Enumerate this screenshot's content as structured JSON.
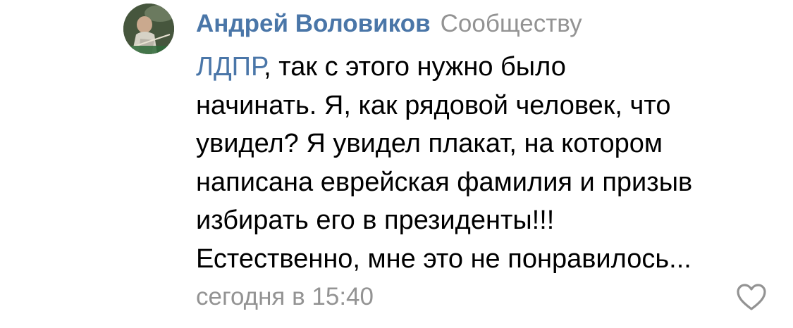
{
  "comment": {
    "author_name": "Андрей Воловиков",
    "reply_to": "Сообществу",
    "mention": "ЛДПР",
    "text_lines": [
      ", так с этого нужно было",
      "начинать. Я, как рядовой человек, что",
      "увидел? Я увидел плакат, на котором",
      "написана еврейская фамилия и призыв",
      "избирать его в президенты!!!",
      "Естественно, мне это не понравилось..."
    ],
    "timestamp": "сегодня в 15:40",
    "avatar_icon": "billiards-player-avatar",
    "like_icon": "heart-outline-icon"
  },
  "colors": {
    "link": "#4a76a8",
    "secondary": "#939393",
    "text": "#000000",
    "background": "#ffffff"
  }
}
